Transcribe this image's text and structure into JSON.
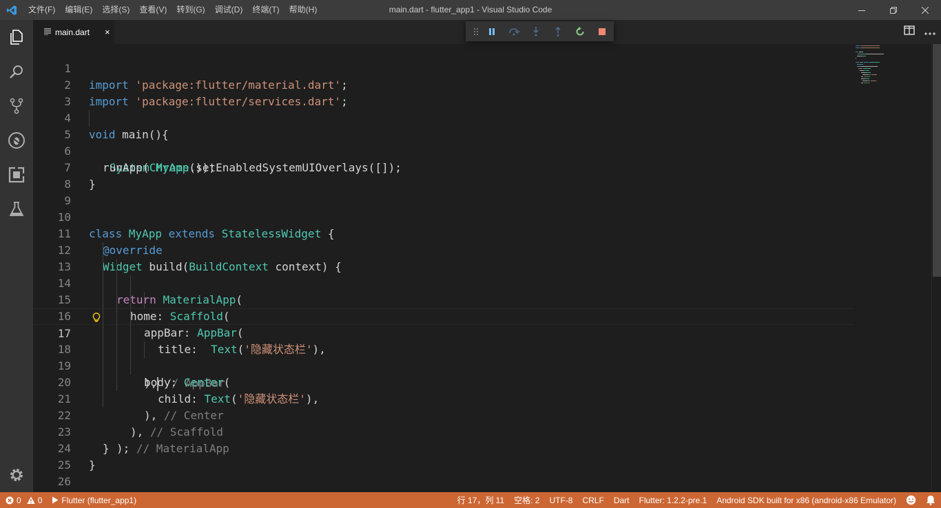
{
  "window": {
    "title": "main.dart - flutter_app1 - Visual Studio Code",
    "menu": [
      "文件(F)",
      "编辑(E)",
      "选择(S)",
      "查看(V)",
      "转到(G)",
      "调试(D)",
      "终端(T)",
      "帮助(H)"
    ]
  },
  "activity_bar": {
    "items": [
      "explorer-icon",
      "search-icon",
      "source-control-icon",
      "debug-icon",
      "extensions-icon",
      "test-flask-icon"
    ],
    "bottom": "gear-icon"
  },
  "tabs": [
    {
      "label": "main.dart",
      "close": "×"
    }
  ],
  "debug_toolbar": [
    "pause-icon",
    "step-over-icon",
    "step-into-icon",
    "step-out-icon",
    "restart-icon",
    "stop-icon"
  ],
  "editor": {
    "current_line": 17,
    "lines": [
      {
        "n": "1"
      },
      {
        "n": "2"
      },
      {
        "n": "3"
      },
      {
        "n": "4"
      },
      {
        "n": "5"
      },
      {
        "n": "6"
      },
      {
        "n": "7"
      },
      {
        "n": "8"
      },
      {
        "n": "9"
      },
      {
        "n": "10"
      },
      {
        "n": "11"
      },
      {
        "n": "12"
      },
      {
        "n": "13"
      },
      {
        "n": "14"
      },
      {
        "n": "15"
      },
      {
        "n": "16"
      },
      {
        "n": "17"
      },
      {
        "n": "18"
      },
      {
        "n": "19"
      },
      {
        "n": "20"
      },
      {
        "n": "21"
      },
      {
        "n": "22"
      },
      {
        "n": "23"
      },
      {
        "n": "24"
      },
      {
        "n": "25"
      },
      {
        "n": "26"
      }
    ],
    "tokens": {
      "l1_kw": "import",
      "l1_str": "'package:flutter/material.dart'",
      "l1_end": ";",
      "l2_kw": "import",
      "l2_str": "'package:flutter/services.dart'",
      "l2_end": ";",
      "l4_kw": "void",
      "l4_rest": " main(){",
      "l5_cls": "SystemChrome",
      "l5_rest": ".setEnabledSystemUIOverlays([]);",
      "l6_a": "runApp( ",
      "l6_cls": "MyApp",
      "l6_b": "());",
      "l7": "}",
      "l10_kw": "class",
      "l10_cls1": "MyApp",
      "l10_kw2": "extends",
      "l10_cls2": "StatelessWidget",
      "l10_end": " {",
      "l11": "@override",
      "l12_cls": "Widget",
      "l12_a": " build(",
      "l12_cls2": "BuildContext",
      "l12_b": " context) {",
      "l13_kw": "return",
      "l13_cls": "MaterialApp",
      "l13_end": "(",
      "l14_a": "home: ",
      "l14_cls": "Scaffold",
      "l14_end": "(",
      "l15_a": "appBar: ",
      "l15_cls": "AppBar",
      "l15_end": "(",
      "l16_a": "title:  ",
      "l16_cls": "Text",
      "l16_b": "(",
      "l16_str": "'隐藏状态栏'",
      "l16_end": "),",
      "l17_a": "),",
      "l17_cmt": " // AppBar",
      "l18_a": "body: ",
      "l18_cls": "Center",
      "l18_end": "(",
      "l19_a": "child: ",
      "l19_cls": "Text",
      "l19_b": "(",
      "l19_str": "'隐藏状态栏'",
      "l19_end": "),",
      "l20_a": "), ",
      "l20_cmt": "// Center",
      "l21_a": "), ",
      "l21_cmt": "// Scaffold",
      "l22_a": "); ",
      "l22_cmt": "// MaterialApp",
      "l23": "}",
      "l24": "}"
    }
  },
  "status_bar": {
    "errors": "0",
    "warnings": "0",
    "debug_session": "Flutter (flutter_app1)",
    "position": "行 17，列 11",
    "indent": "空格: 2",
    "encoding": "UTF-8",
    "eol": "CRLF",
    "language": "Dart",
    "flutter_version": "Flutter: 1.2.2-pre.1",
    "device": "Android SDK built for x86 (android-x86 Emulator)",
    "colors": {
      "background": "#cc6633"
    }
  }
}
